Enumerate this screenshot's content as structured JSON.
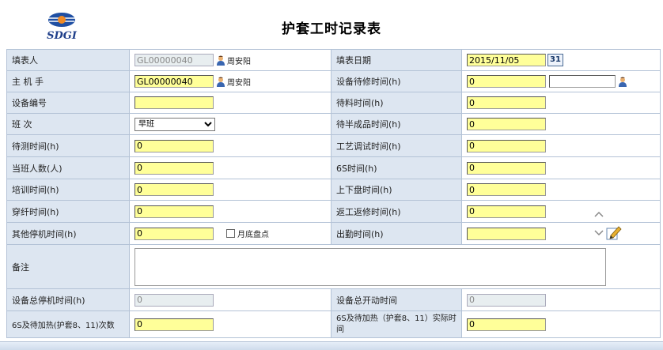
{
  "header": {
    "title": "护套工时记录表",
    "logo_text": "SDGI"
  },
  "rows": [
    {
      "l1": "填表人",
      "v1": "GL00000040",
      "n1": "周安阳",
      "l2": "填表日期",
      "v2": "2015/11/05",
      "cal": "31"
    },
    {
      "l1": "主 机 手",
      "v1": "GL00000040",
      "n1": "周安阳",
      "l2": "设备待修时间(h)",
      "v2": "0",
      "v2b": ""
    },
    {
      "l1": "设备编号",
      "v1": "",
      "l2": "待料时间(h)",
      "v2": "0"
    },
    {
      "l1": "班 次",
      "v1": "早班",
      "l2": "待半成品时间(h)",
      "v2": "0"
    },
    {
      "l1": "待测时间(h)",
      "v1": "0",
      "l2": "工艺调试时间(h)",
      "v2": "0"
    },
    {
      "l1": "当班人数(人)",
      "v1": "0",
      "l2": "6S时间(h)",
      "v2": "0"
    },
    {
      "l1": "培训时间(h)",
      "v1": "0",
      "l2": "上下盘时间(h)",
      "v2": "0"
    },
    {
      "l1": "穿纤时间(h)",
      "v1": "0",
      "l2": "返工返修时间(h)",
      "v2": "0"
    },
    {
      "l1": "其他停机时间(h)",
      "v1": "0",
      "chk": "月底盘点",
      "l2": "出勤时间(h)",
      "v2": ""
    },
    {
      "l1": "备注",
      "v1": ""
    },
    {
      "l1": "设备总停机时间(h)",
      "v1": "0",
      "l2": "设备总开动时间",
      "v2": "0"
    },
    {
      "l1": "6S及待加热(护套8、11)次数",
      "v1": "0",
      "l2": "6S及待加热（护套8、11）实际时间",
      "v2": "0"
    }
  ],
  "colors": {
    "label_bg": "#dde6f1",
    "input_bg": "#ffff99",
    "border": "#b3c2d6"
  }
}
